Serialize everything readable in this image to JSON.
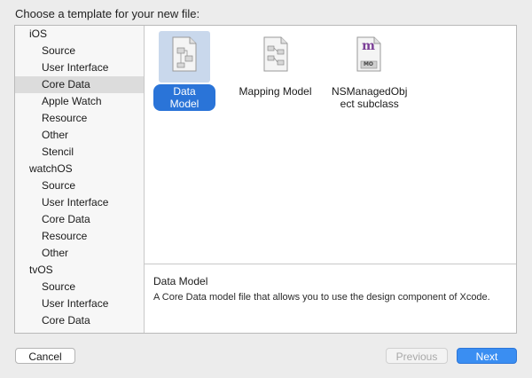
{
  "dialog": {
    "title": "Choose a template for your new file:"
  },
  "sidebar": {
    "groups": [
      {
        "label": "iOS",
        "items": [
          "Source",
          "User Interface",
          "Core Data",
          "Apple Watch",
          "Resource",
          "Other",
          "Stencil"
        ]
      },
      {
        "label": "watchOS",
        "items": [
          "Source",
          "User Interface",
          "Core Data",
          "Resource",
          "Other"
        ]
      },
      {
        "label": "tvOS",
        "items": [
          "Source",
          "User Interface",
          "Core Data"
        ]
      }
    ],
    "selected": "iOS / Core Data"
  },
  "templates": [
    {
      "label": "Data Model",
      "icon": "data-model-icon",
      "selected": true
    },
    {
      "label": "Mapping Model",
      "icon": "mapping-model-icon",
      "selected": false
    },
    {
      "label_line1": "NSManagedObj",
      "label_line2": "ect subclass",
      "icon": "nsmanagedobject-icon",
      "icon_glyph": "m",
      "icon_badge": "MO",
      "selected": false
    }
  ],
  "description": {
    "title": "Data Model",
    "text": "A Core Data model file that allows you to use the design component of Xcode."
  },
  "buttons": {
    "cancel": "Cancel",
    "previous": "Previous",
    "next": "Next"
  },
  "colors": {
    "accent": "#2a74d8",
    "next_button": "#3a8ef2",
    "selection_bg": "#dcdcdc",
    "icon_selection_bg": "#c9d8ec"
  }
}
